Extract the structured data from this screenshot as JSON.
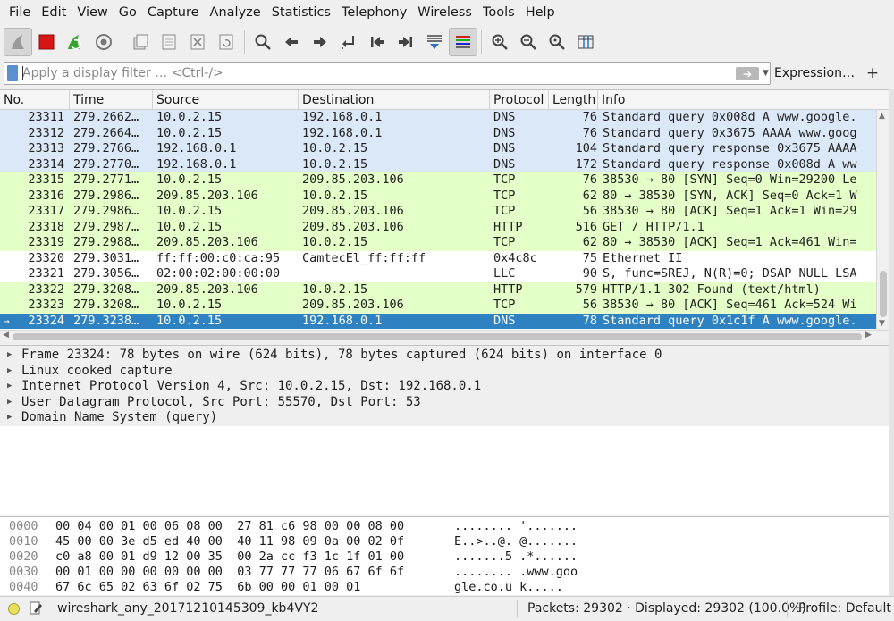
{
  "menu": [
    "File",
    "Edit",
    "View",
    "Go",
    "Capture",
    "Analyze",
    "Statistics",
    "Telephony",
    "Wireless",
    "Tools",
    "Help"
  ],
  "toolbar": {
    "icons": [
      "shark-fin-start-icon",
      "stop-square-icon",
      "restart-fin-icon",
      "capture-options-gear-icon",
      "open-file-icon",
      "save-file-icon",
      "close-file-icon",
      "reload-file-icon",
      "find-packet-icon",
      "go-back-icon",
      "go-forward-icon",
      "go-to-packet-icon",
      "first-packet-icon",
      "last-packet-icon",
      "auto-scroll-icon",
      "colorize-icon",
      "zoom-in-icon",
      "zoom-out-icon",
      "zoom-normal-icon",
      "resize-columns-icon"
    ]
  },
  "filter": {
    "placeholder": "Apply a display filter … <Ctrl-/>",
    "expression_label": "Expression…",
    "plus_label": "+"
  },
  "columns": [
    "No.",
    "Time",
    "Source",
    "Destination",
    "Protocol",
    "Length",
    "Info"
  ],
  "packets": [
    {
      "no": "23311",
      "time": "279.2662…",
      "src": "10.0.2.15",
      "dst": "192.168.0.1",
      "proto": "DNS",
      "len": "76",
      "info": "Standard query 0x008d A www.google.",
      "color": "#dae8f7"
    },
    {
      "no": "23312",
      "time": "279.2664…",
      "src": "10.0.2.15",
      "dst": "192.168.0.1",
      "proto": "DNS",
      "len": "76",
      "info": "Standard query 0x3675 AAAA www.goog",
      "color": "#dae8f7"
    },
    {
      "no": "23313",
      "time": "279.2766…",
      "src": "192.168.0.1",
      "dst": "10.0.2.15",
      "proto": "DNS",
      "len": "104",
      "info": "Standard query response 0x3675 AAAA",
      "color": "#dae8f7"
    },
    {
      "no": "23314",
      "time": "279.2770…",
      "src": "192.168.0.1",
      "dst": "10.0.2.15",
      "proto": "DNS",
      "len": "172",
      "info": "Standard query response 0x008d A ww",
      "color": "#dae8f7"
    },
    {
      "no": "23315",
      "time": "279.2771…",
      "src": "10.0.2.15",
      "dst": "209.85.203.106",
      "proto": "TCP",
      "len": "76",
      "info": "38530 → 80 [SYN] Seq=0 Win=29200 Le",
      "color": "#e4ffc7"
    },
    {
      "no": "23316",
      "time": "279.2986…",
      "src": "209.85.203.106",
      "dst": "10.0.2.15",
      "proto": "TCP",
      "len": "62",
      "info": "80 → 38530 [SYN, ACK] Seq=0 Ack=1 W",
      "color": "#e4ffc7"
    },
    {
      "no": "23317",
      "time": "279.2986…",
      "src": "10.0.2.15",
      "dst": "209.85.203.106",
      "proto": "TCP",
      "len": "56",
      "info": "38530 → 80 [ACK] Seq=1 Ack=1 Win=29",
      "color": "#e4ffc7"
    },
    {
      "no": "23318",
      "time": "279.2987…",
      "src": "10.0.2.15",
      "dst": "209.85.203.106",
      "proto": "HTTP",
      "len": "516",
      "info": "GET / HTTP/1.1",
      "color": "#e4ffc7"
    },
    {
      "no": "23319",
      "time": "279.2988…",
      "src": "209.85.203.106",
      "dst": "10.0.2.15",
      "proto": "TCP",
      "len": "62",
      "info": "80 → 38530 [ACK] Seq=1 Ack=461 Win=",
      "color": "#e4ffc7"
    },
    {
      "no": "23320",
      "time": "279.3031…",
      "src": "ff:ff:00:c0:ca:95",
      "dst": "CamtecEl_ff:ff:ff",
      "proto": "0x4c8c",
      "len": "75",
      "info": "Ethernet II",
      "color": "#ffffff"
    },
    {
      "no": "23321",
      "time": "279.3056…",
      "src": "02:00:02:00:00:00",
      "dst": "",
      "proto": "LLC",
      "len": "90",
      "info": "S, func=SREJ, N(R)=0; DSAP NULL LSA",
      "color": "#ffffff"
    },
    {
      "no": "23322",
      "time": "279.3208…",
      "src": "209.85.203.106",
      "dst": "10.0.2.15",
      "proto": "HTTP",
      "len": "579",
      "info": "HTTP/1.1 302 Found  (text/html)",
      "color": "#e4ffc7"
    },
    {
      "no": "23323",
      "time": "279.3208…",
      "src": "10.0.2.15",
      "dst": "209.85.203.106",
      "proto": "TCP",
      "len": "56",
      "info": "38530 → 80 [ACK] Seq=461 Ack=524 Wi",
      "color": "#e4ffc7"
    },
    {
      "no": "23324",
      "time": "279.3238…",
      "src": "10.0.2.15",
      "dst": "192.168.0.1",
      "proto": "DNS",
      "len": "78",
      "info": "Standard query 0x1c1f A www.google.",
      "color": "#2f82c2",
      "selected": true
    }
  ],
  "details": [
    "Frame 23324: 78 bytes on wire (624 bits), 78 bytes captured (624 bits) on interface 0",
    "Linux cooked capture",
    "Internet Protocol Version 4, Src: 10.0.2.15, Dst: 192.168.0.1",
    "User Datagram Protocol, Src Port: 55570, Dst Port: 53",
    "Domain Name System (query)"
  ],
  "hex": [
    {
      "offset": "0000",
      "bytes": "00 04 00 01 00 06 08 00  27 81 c6 98 00 00 08 00",
      "ascii": "........ '......."
    },
    {
      "offset": "0010",
      "bytes": "45 00 00 3e d5 ed 40 00  40 11 98 09 0a 00 02 0f",
      "ascii": "E..>..@. @......."
    },
    {
      "offset": "0020",
      "bytes": "c0 a8 00 01 d9 12 00 35  00 2a cc f3 1c 1f 01 00",
      "ascii": ".......5 .*......"
    },
    {
      "offset": "0030",
      "bytes": "00 01 00 00 00 00 00 00  03 77 77 77 06 67 6f 6f",
      "ascii": "........ .www.goo"
    },
    {
      "offset": "0040",
      "bytes": "67 6c 65 02 63 6f 02 75  6b 00 00 01 00 01",
      "ascii": "gle.co.u k....."
    }
  ],
  "status": {
    "file": "wireshark_any_20171210145309_kb4VY2",
    "packets": "Packets: 29302 · Displayed: 29302 (100.0%)",
    "profile": "Profile: Default"
  },
  "colors": {
    "dns_row": "#dae8f7",
    "tcp_http_row": "#e4ffc7",
    "selected_row": "#2f82c2",
    "stop_red": "#d61515",
    "restart_green": "#35a52c"
  }
}
